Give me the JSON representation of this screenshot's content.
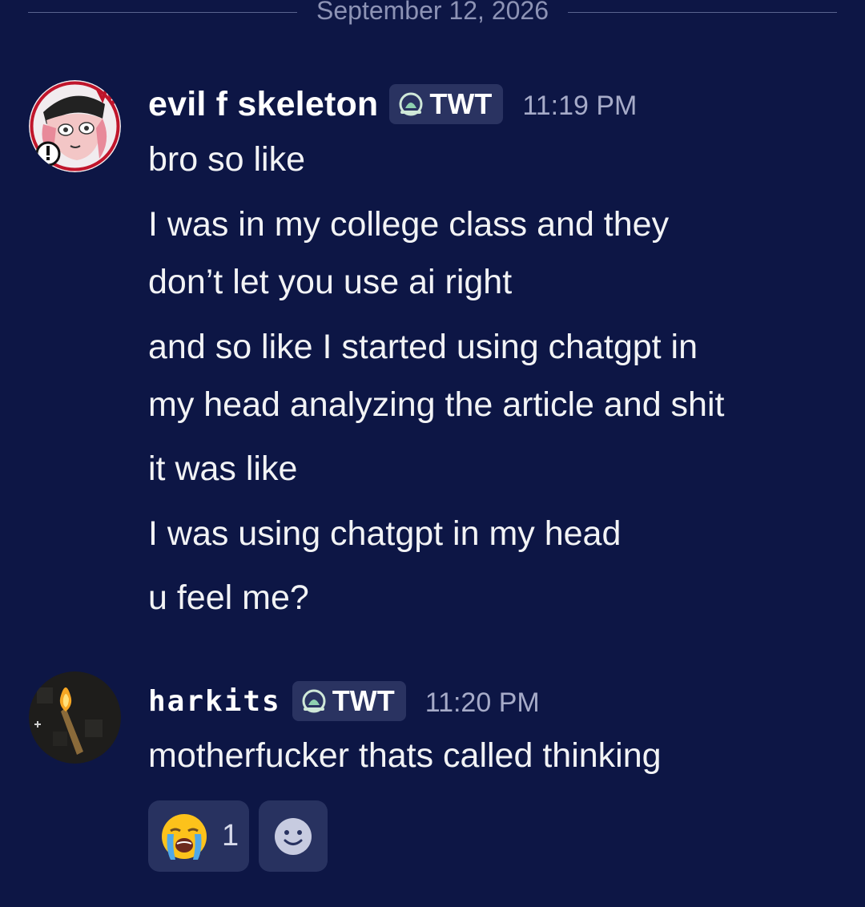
{
  "date_divider": "September 12, 2026",
  "messages": [
    {
      "username": "evil f skeleton",
      "tag": "TWT",
      "time": "11:19 PM",
      "lines": [
        "bro so like",
        "I was in my college class and they",
        "don’t let you use ai right",
        "and so like I started using chatgpt in",
        "my head analyzing the article and shit",
        "it was like",
        "I was using chatgpt in my head",
        "u feel me?"
      ]
    },
    {
      "username": "harkits",
      "tag": "TWT",
      "time": "11:20 PM",
      "lines": [
        "motherfucker thats called thinking"
      ]
    }
  ],
  "reactions": [
    {
      "emoji": "loudly-crying-face",
      "count": "1"
    }
  ],
  "add_reaction_icon": "smiley-add-reaction-icon",
  "colors": {
    "background": "#0d1645",
    "tag_background": "#2a3361",
    "reaction_background": "#283260",
    "timestamp": "#a6abc8"
  }
}
